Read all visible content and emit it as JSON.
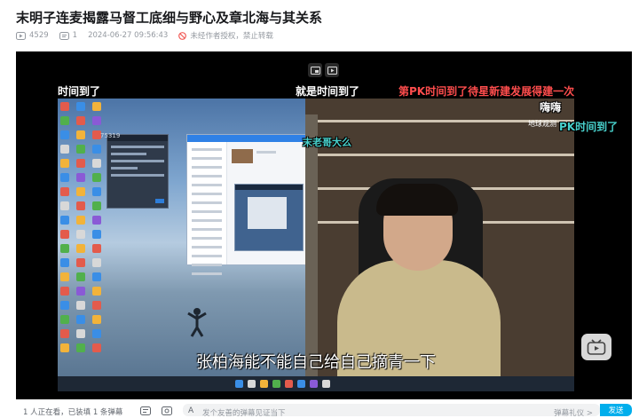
{
  "video": {
    "title": "末明子连麦揭露马督工底细与野心及章北海与其关系",
    "views": "4529",
    "comments": "1",
    "publish_time": "2024-06-27 09:56:43",
    "copyright_notice": "未经作者授权，禁止转载"
  },
  "player": {
    "subtitle": "张柏海能不能自己给自己摘青一下",
    "overlay_texts": {
      "top_left": "时间到了",
      "top_middle": "就是时间到了",
      "top_right": "第PK时间到了待星新建发展得建一次",
      "cam_top_right": "嗨嗨",
      "cam_right": "PK时间到了",
      "cam_left": "末老哥大么",
      "user_id": "75319"
    },
    "logo_text": "地球观测",
    "icons": [
      "pip-icon",
      "screenshot-icon",
      "bilibili-tv-icon"
    ],
    "accent_color": "#00aeec"
  },
  "danmaku_bar": {
    "status": "1 人正在看，已装填 1 条弹幕",
    "input_prefix": "A",
    "input_placeholder": "发个友善的弹幕见证当下",
    "etiquette": "弹幕礼仪 >",
    "send_label": "发送"
  }
}
